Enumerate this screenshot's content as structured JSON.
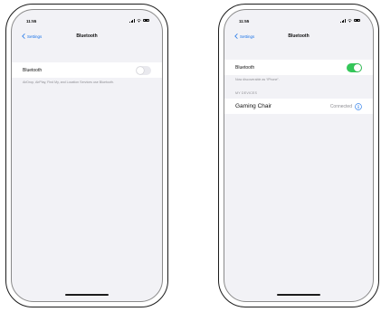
{
  "colors": {
    "accent": "#1a73e8",
    "toggle_on": "#34c759",
    "toggle_off": "#e9e9ee",
    "background": "#f2f2f6"
  },
  "left_phone": {
    "status_bar": {
      "time": "11:55",
      "icons": [
        "signal-icon",
        "wifi-icon",
        "battery-icon"
      ]
    },
    "nav": {
      "back_label": "Settings",
      "title": "Bluetooth"
    },
    "bluetooth_row": {
      "label": "Bluetooth",
      "toggle_state": "off"
    },
    "footnote": "AirDrop, AirPlay, Find My, and Location Services use Bluetooth."
  },
  "right_phone": {
    "status_bar": {
      "time": "11:55",
      "icons": [
        "signal-icon",
        "wifi-icon",
        "battery-icon"
      ]
    },
    "nav": {
      "back_label": "Settings",
      "title": "Bluetooth"
    },
    "bluetooth_row": {
      "label": "Bluetooth",
      "toggle_state": "on"
    },
    "discoverable_note": "Now discoverable as “iPhone”.",
    "section_header": "MY DEVICES",
    "device": {
      "name": "Gaming Chair",
      "status": "Connected",
      "info_icon": "info-icon"
    }
  }
}
